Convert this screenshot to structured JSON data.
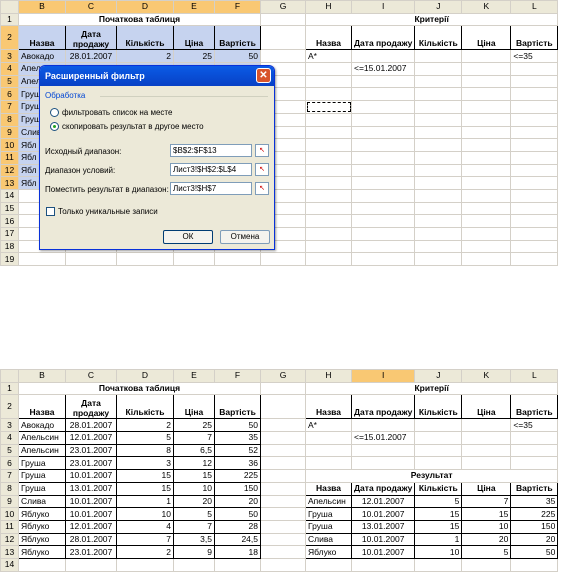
{
  "top_sheet": {
    "col_headers": [
      "",
      "B",
      "C",
      "D",
      "E",
      "F",
      "G",
      "H",
      "I",
      "J",
      "K",
      "L"
    ],
    "row_numbers": [
      "1",
      "2",
      "3",
      "4",
      "5",
      "6",
      "7",
      "8",
      "9",
      "10",
      "11",
      "12",
      "13",
      "14",
      "15",
      "16",
      "17",
      "18",
      "19"
    ],
    "title_source": "Початкова таблиця",
    "title_criteria": "Критерії",
    "headers": [
      "Назва",
      "Дата продажу",
      "Кількість",
      "Ціна",
      "Вартість"
    ],
    "first_row": [
      "Авокадо",
      "28.01.2007",
      "2",
      "25",
      "50"
    ],
    "partial_names": [
      "Апел",
      "Апел",
      "Груш",
      "Груш",
      "Груш",
      "Слив",
      "Ябл",
      "Ябл",
      "Ябл",
      "Ябл"
    ],
    "criteria_a": "А*",
    "criteria_l": "<=35",
    "criteria_date": "<=15.01.2007"
  },
  "dialog": {
    "title": "Расширенный фильтр",
    "close_glyph": "✕",
    "group_label": "Обработка",
    "radio_in_place": "фильтровать список на месте",
    "radio_copy": "скопировать результат в другое место",
    "label_source": "Исходный диапазон:",
    "value_source": "$B$2:$F$13",
    "label_criteria": "Диапазон условий:",
    "value_criteria": "Лист3!$H$2:$L$4",
    "label_dest": "Поместить результат в диапазон:",
    "value_dest": "Лист3!$H$7",
    "checkbox_unique": "Только уникальные записи",
    "ok": "ОК",
    "cancel": "Отмена",
    "ref_glyph": "↖"
  },
  "bottom_sheet": {
    "title_source": "Початкова таблиця",
    "title_criteria": "Критерії",
    "title_result": "Результат",
    "headers": [
      "Назва",
      "Дата продажу",
      "Кількість",
      "Ціна",
      "Вартість"
    ],
    "rows": [
      [
        "Авокадо",
        "28.01.2007",
        "2",
        "25",
        "50"
      ],
      [
        "Апельсин",
        "12.01.2007",
        "5",
        "7",
        "35"
      ],
      [
        "Апельсин",
        "23.01.2007",
        "8",
        "6,5",
        "52"
      ],
      [
        "Груша",
        "23.01.2007",
        "3",
        "12",
        "36"
      ],
      [
        "Груша",
        "10.01.2007",
        "15",
        "15",
        "225"
      ],
      [
        "Груша",
        "13.01.2007",
        "15",
        "10",
        "150"
      ],
      [
        "Слива",
        "10.01.2007",
        "1",
        "20",
        "20"
      ],
      [
        "Яблуко",
        "10.01.2007",
        "10",
        "5",
        "50"
      ],
      [
        "Яблуко",
        "12.01.2007",
        "4",
        "7",
        "28"
      ],
      [
        "Яблуко",
        "28.01.2007",
        "7",
        "3,5",
        "24,5"
      ],
      [
        "Яблуко",
        "23.01.2007",
        "2",
        "9",
        "18"
      ]
    ],
    "result_rows": [
      [
        "Апельсин",
        "12.01.2007",
        "5",
        "7",
        "35"
      ],
      [
        "Груша",
        "10.01.2007",
        "15",
        "15",
        "225"
      ],
      [
        "Груша",
        "13.01.2007",
        "15",
        "10",
        "150"
      ],
      [
        "Слива",
        "10.01.2007",
        "1",
        "20",
        "20"
      ],
      [
        "Яблуко",
        "10.01.2007",
        "10",
        "5",
        "50"
      ],
      [
        "Яблуко",
        "12.01.2007",
        "4",
        "7",
        "28"
      ]
    ],
    "criteria_a": "А*",
    "criteria_l": "<=35",
    "criteria_date": "<=15.01.2007"
  }
}
